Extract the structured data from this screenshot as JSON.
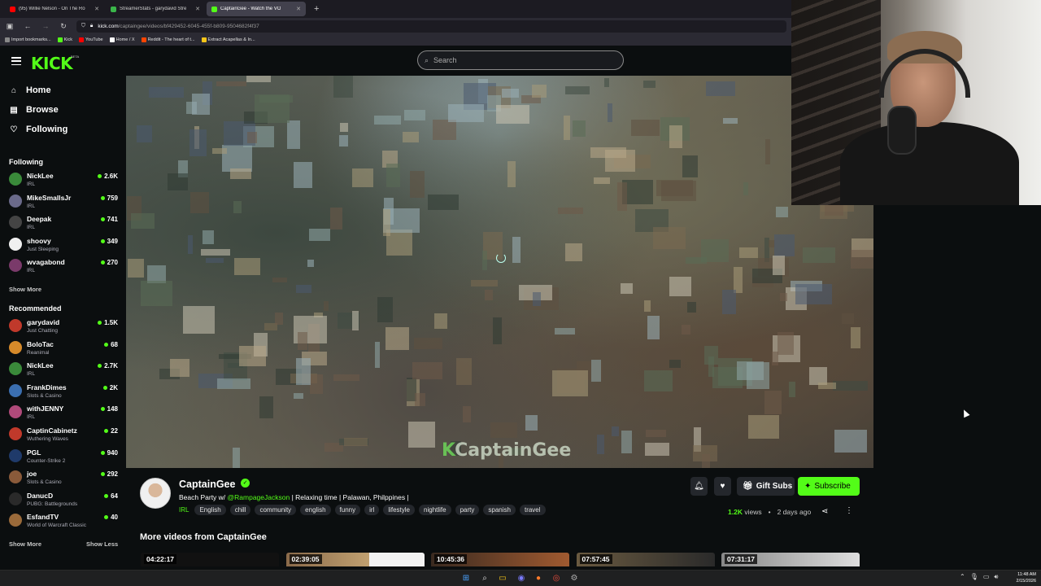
{
  "browser": {
    "tabs": [
      {
        "title": "(95) Willie Nelson - On The Ro",
        "color": "#ff0000",
        "active": false
      },
      {
        "title": "StreamerStats - garydavid Stre",
        "color": "#3ab54a",
        "active": false
      },
      {
        "title": "CaptainGee - Watch the VO",
        "color": "#53fc18",
        "active": true
      }
    ],
    "new_tab": "+",
    "url_host": "kick.com",
    "url_path": "/captaingee/videos/bf429452-6045-455f-b809-9504682f4f37",
    "bookmarks": [
      {
        "label": "Import bookmarks...",
        "color": "#888888"
      },
      {
        "label": "Kick",
        "color": "#53fc18"
      },
      {
        "label": "YouTube",
        "color": "#ff0000"
      },
      {
        "label": "Home / X",
        "color": "#ffffff"
      },
      {
        "label": "Reddit - The heart of t...",
        "color": "#ff4500"
      },
      {
        "label": "Extract Acapellas & In...",
        "color": "#f5c518"
      }
    ]
  },
  "header": {
    "logo": "KICK",
    "beta": "BETA",
    "search_placeholder": "Search"
  },
  "sidebar": {
    "nav": [
      {
        "label": "Home",
        "icon": "home-icon"
      },
      {
        "label": "Browse",
        "icon": "browse-icon"
      },
      {
        "label": "Following",
        "icon": "heart-icon"
      }
    ],
    "following_title": "Following",
    "following": [
      {
        "name": "NickLee",
        "category": "IRL",
        "viewers": "2.6K",
        "color": "#3a8a3a"
      },
      {
        "name": "MikeSmallsJr",
        "category": "IRL",
        "viewers": "759",
        "color": "#6a6a8a"
      },
      {
        "name": "Deepak",
        "category": "IRL",
        "viewers": "741",
        "color": "#444444"
      },
      {
        "name": "shoovy",
        "category": "Just Sleeping",
        "viewers": "349",
        "color": "#f0f0f0"
      },
      {
        "name": "wvagabond",
        "category": "IRL",
        "viewers": "270",
        "color": "#7a3a6a"
      }
    ],
    "show_more_following": "Show More",
    "recommended_title": "Recommended",
    "recommended": [
      {
        "name": "garydavid",
        "category": "Just Chatting",
        "viewers": "1.5K",
        "color": "#c0392b"
      },
      {
        "name": "BoloTac",
        "category": "Reanimal",
        "viewers": "68",
        "color": "#d68a2a"
      },
      {
        "name": "NickLee",
        "category": "IRL",
        "viewers": "2.7K",
        "color": "#3a8a3a"
      },
      {
        "name": "FrankDimes",
        "category": "Slots & Casino",
        "viewers": "2K",
        "color": "#3b6fb0"
      },
      {
        "name": "withJENNY",
        "category": "IRL",
        "viewers": "148",
        "color": "#b04a7a"
      },
      {
        "name": "CaptinCabinetz",
        "category": "Wuthering Waves",
        "viewers": "22",
        "color": "#c0392b"
      },
      {
        "name": "PGL",
        "category": "Counter-Strike 2",
        "viewers": "940",
        "color": "#1f3a6a"
      },
      {
        "name": "joe",
        "category": "Slots & Casino",
        "viewers": "292",
        "color": "#8a5a3a"
      },
      {
        "name": "DanucD",
        "category": "PUBG: Battlegrounds",
        "viewers": "64",
        "color": "#2a2a2a"
      },
      {
        "name": "EsfandTV",
        "category": "World of Warcraft Classic",
        "viewers": "40",
        "color": "#9a6a3a"
      }
    ],
    "show_more": "Show More",
    "show_less": "Show Less"
  },
  "video": {
    "watermark_k": "K",
    "watermark": "CaptainGee"
  },
  "channel": {
    "name": "CaptainGee",
    "title_prefix": "Beach Party w/ ",
    "title_mention": "@RampageJackson",
    "title_suffix": " | Relaxing time | Palawan, Philppines |",
    "category": "IRL",
    "tags": [
      "English",
      "chill",
      "community",
      "english",
      "funny",
      "irl",
      "lifestyle",
      "nightlife",
      "party",
      "spanish",
      "travel"
    ],
    "gift_label": "Gift Subs",
    "subscribe_label": "Subscribe",
    "views_count": "1.2K",
    "views_label": "views",
    "sep": "•",
    "age": "2 days ago"
  },
  "more_videos": {
    "title": "More videos from CaptainGee",
    "items": [
      {
        "duration": "04:22:17"
      },
      {
        "duration": "02:39:05"
      },
      {
        "duration": "10:45:36"
      },
      {
        "duration": "07:57:45"
      },
      {
        "duration": "07:31:17"
      }
    ]
  },
  "taskbar": {
    "time": "11:48 AM",
    "date": "2/15/2026"
  }
}
